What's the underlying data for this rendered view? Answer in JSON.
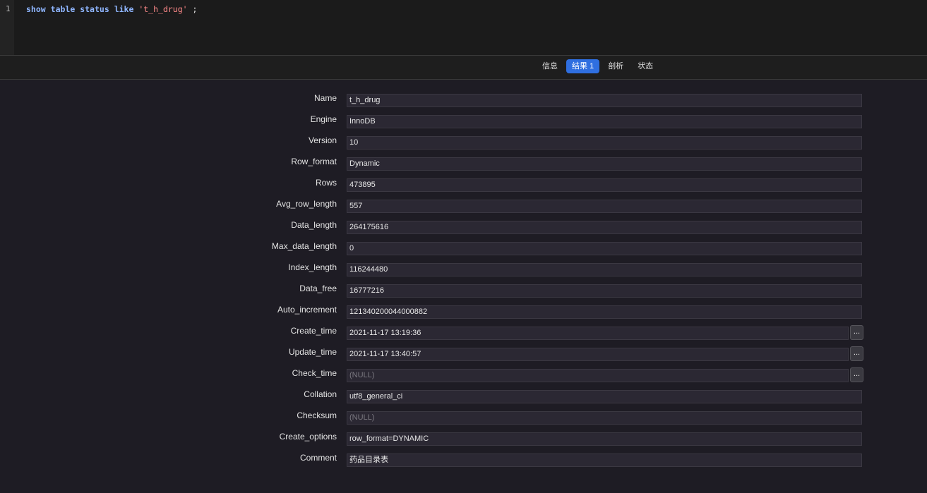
{
  "editor": {
    "line_number": "1",
    "code": {
      "kw1": "show",
      "kw2": "table",
      "kw3": "status",
      "kw4": "like",
      "string": "'t_h_drug'",
      "end": ";"
    }
  },
  "tabs": [
    {
      "label": "信息",
      "active": false
    },
    {
      "label": "结果 1",
      "active": true
    },
    {
      "label": "剖析",
      "active": false
    },
    {
      "label": "状态",
      "active": false
    }
  ],
  "fields": [
    {
      "label": "Name",
      "value": "t_h_drug"
    },
    {
      "label": "Engine",
      "value": "InnoDB"
    },
    {
      "label": "Version",
      "value": "10"
    },
    {
      "label": "Row_format",
      "value": "Dynamic"
    },
    {
      "label": "Rows",
      "value": "473895"
    },
    {
      "label": "Avg_row_length",
      "value": "557"
    },
    {
      "label": "Data_length",
      "value": "264175616"
    },
    {
      "label": "Max_data_length",
      "value": "0"
    },
    {
      "label": "Index_length",
      "value": "116244480"
    },
    {
      "label": "Data_free",
      "value": "16777216"
    },
    {
      "label": "Auto_increment",
      "value": "121340200044000882"
    },
    {
      "label": "Create_time",
      "value": "2021-11-17 13:19:36",
      "button": "..."
    },
    {
      "label": "Update_time",
      "value": "2021-11-17 13:40:57",
      "button": "..."
    },
    {
      "label": "Check_time",
      "value": "(NULL)",
      "button": "...",
      "null": true
    },
    {
      "label": "Collation",
      "value": "utf8_general_ci"
    },
    {
      "label": "Checksum",
      "value": "(NULL)",
      "null": true
    },
    {
      "label": "Create_options",
      "value": "row_format=DYNAMIC"
    },
    {
      "label": "Comment",
      "value": "药品目录表"
    }
  ]
}
